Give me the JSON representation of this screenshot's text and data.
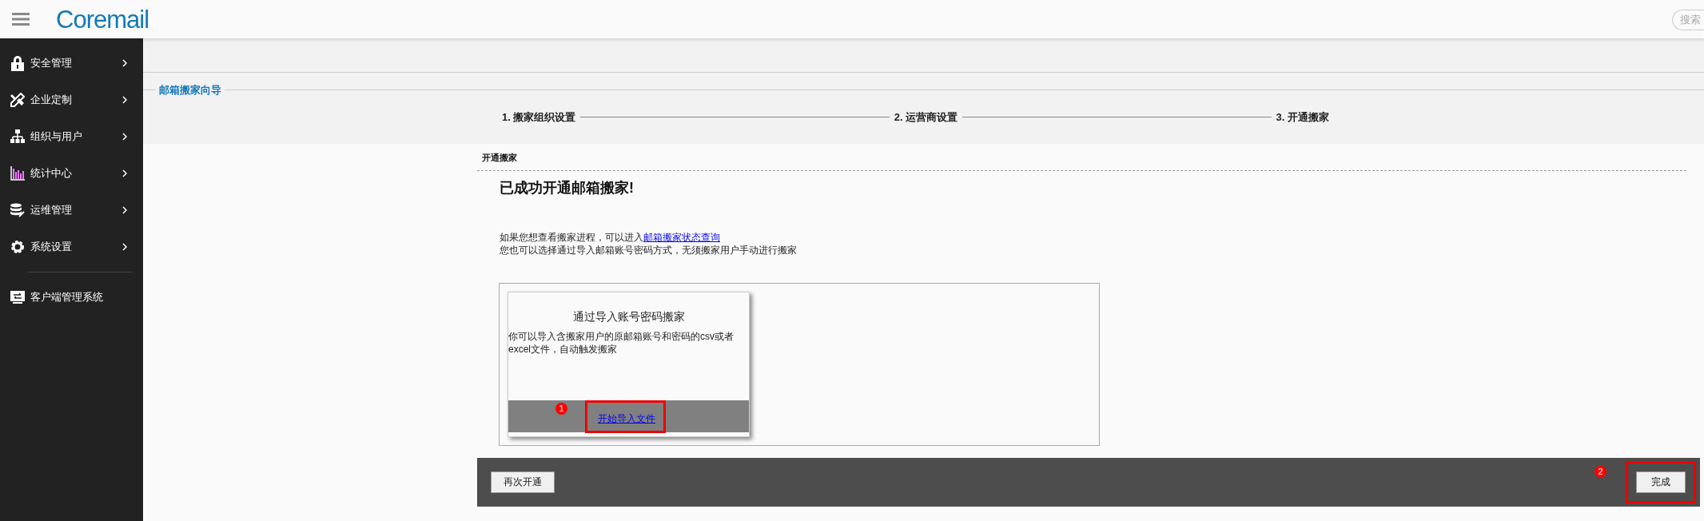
{
  "header": {
    "logo": "Coremail",
    "search": {
      "placeholder": "搜索"
    }
  },
  "sidebar": {
    "items": [
      {
        "label": "安全管理"
      },
      {
        "label": "企业定制"
      },
      {
        "label": "组织与用户"
      },
      {
        "label": "统计中心"
      },
      {
        "label": "运维管理"
      },
      {
        "label": "系统设置"
      }
    ],
    "bottom_items": [
      {
        "label": "客户端管理系统"
      }
    ]
  },
  "wizard": {
    "title": "邮箱搬家向导",
    "steps": [
      {
        "label": "1. 搬家组织设置"
      },
      {
        "label": "2. 运营商设置"
      },
      {
        "label": "3. 开通搬家"
      }
    ]
  },
  "section": {
    "title": "开通搬家",
    "heading": "已成功开通邮箱搬家!",
    "line_1": "如果您想查看搬家进程，可以进入",
    "line_1_link": "邮箱搬家状态查询",
    "line_2": "您也可以选择通过导入邮箱账号密码方式，无须搬家用户手动进行搬家"
  },
  "card": {
    "title": "通过导入账号密码搬家",
    "description": "你可以导入含搬家用户的原邮箱账号和密码的csv或者excel文件，自动触发搬家",
    "link": "开始导入文件",
    "marker": "1"
  },
  "footer": {
    "left_button": "再次开通",
    "right_button": "完成",
    "marker": "2"
  }
}
